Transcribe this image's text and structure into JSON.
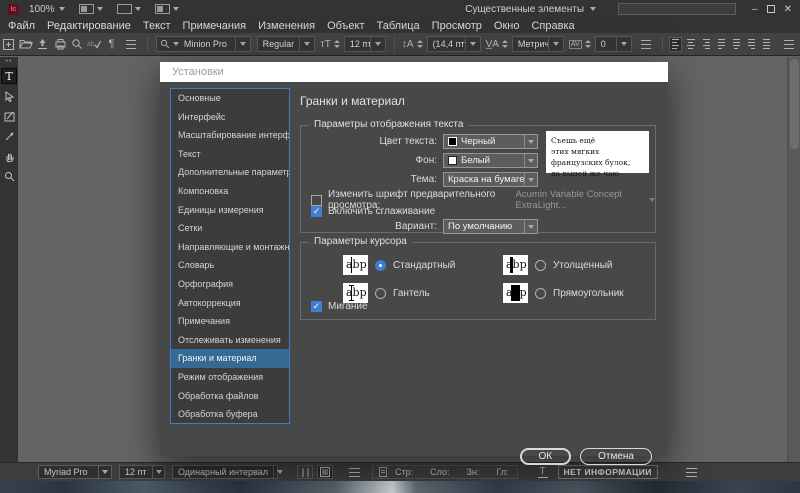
{
  "colors": {
    "accent_blue": "#3d7fd0",
    "sidebar_selection": "#366a93",
    "brand_maroon": "#5c121c",
    "dialog_bg": "#484848",
    "app_bar_bg": "#333333"
  },
  "app": {
    "logo_text": "Ic",
    "zoom_level": "100%",
    "workspace": "Существенные элементы",
    "menus": [
      "Файл",
      "Редактирование",
      "Текст",
      "Примечания",
      "Изменения",
      "Объект",
      "Таблица",
      "Просмотр",
      "Окно",
      "Справка"
    ],
    "window_controls": {
      "minimize": "–",
      "close": "✕"
    }
  },
  "toolbar": {
    "icons": [
      "new-document",
      "open",
      "save-content",
      "print",
      "search",
      "spell-check",
      "show-hidden-characters",
      "panel-menu"
    ],
    "font_family": "Minion Pro",
    "font_style": "Regular",
    "font_size": "12 пт",
    "size_icon": "тT",
    "leading": "(14,4 пт)",
    "kerning": "Метрич.",
    "kerning_icon": "V̲A",
    "tracking": "0",
    "align_options": [
      "align-left",
      "align-center",
      "align-right",
      "justify-left",
      "justify-center",
      "justify-right",
      "justify-all"
    ]
  },
  "tools": [
    "type",
    "position",
    "note",
    "eyedropper",
    "hand",
    "zoom"
  ],
  "dialog": {
    "title": "Установки",
    "sidebar": [
      {
        "label": "Основные",
        "selected": false
      },
      {
        "label": "Интерфейс",
        "selected": false
      },
      {
        "label": "Масштабирование интерфейса",
        "selected": false
      },
      {
        "label": "Текст",
        "selected": false
      },
      {
        "label": "Дополнительные параметры текста",
        "selected": false
      },
      {
        "label": "Компоновка",
        "selected": false
      },
      {
        "label": "Единицы измерения",
        "selected": false
      },
      {
        "label": "Сетки",
        "selected": false
      },
      {
        "label": "Направляющие и монтажный стол",
        "selected": false
      },
      {
        "label": "Словарь",
        "selected": false
      },
      {
        "label": "Орфография",
        "selected": false
      },
      {
        "label": "Автокоррекция",
        "selected": false
      },
      {
        "label": "Примечания",
        "selected": false
      },
      {
        "label": "Отслеживать изменения",
        "selected": false
      },
      {
        "label": "Гранки и материал",
        "selected": true
      },
      {
        "label": "Режим отображения",
        "selected": false
      },
      {
        "label": "Обработка файлов",
        "selected": false
      },
      {
        "label": "Обработка буфера",
        "selected": false
      }
    ],
    "heading": "Гранки и материал",
    "text_display": {
      "legend": "Параметры отображения текста",
      "text_color_label": "Цвет текста:",
      "text_color_value": "Черный",
      "background_label": "Фон:",
      "background_value": "Белый",
      "theme_label": "Тема:",
      "theme_value": "Краска на бумаге",
      "preview_line1": "Съешь ещё",
      "preview_line2": "этих мягких французских булок,",
      "preview_line3": "да выпей же чаю",
      "override_font_label": "Изменить шрифт предварительного просмотра:",
      "override_font_checked": false,
      "override_font_value": "Acumin Variable Concept ExtraLight...",
      "antialias_label": "Включить сглаживание",
      "antialias_checked": true,
      "variant_label": "Вариант:",
      "variant_value": "По умолчанию"
    },
    "cursor": {
      "legend": "Параметры курсора",
      "icon_text": "abp",
      "options": [
        {
          "label": "Стандартный",
          "style": "standard",
          "selected": true
        },
        {
          "label": "Утолщенный",
          "style": "thick",
          "selected": false
        },
        {
          "label": "Гантель",
          "style": "barbell",
          "selected": false
        },
        {
          "label": "Прямоугольник",
          "style": "block",
          "selected": false
        }
      ],
      "blink_label": "Мигание",
      "blink_checked": true
    },
    "ok_label": "ОК",
    "cancel_label": "Отмена"
  },
  "statusbar": {
    "font": "Myriad Pro",
    "size": "12 пт",
    "spacing": "Одинарный интервал",
    "counters": [
      "Стр:",
      "Сло:",
      "Зн:",
      "Гл:"
    ],
    "depth_icon": "T",
    "info": "НЕТ ИНФОРМАЦИИ"
  }
}
